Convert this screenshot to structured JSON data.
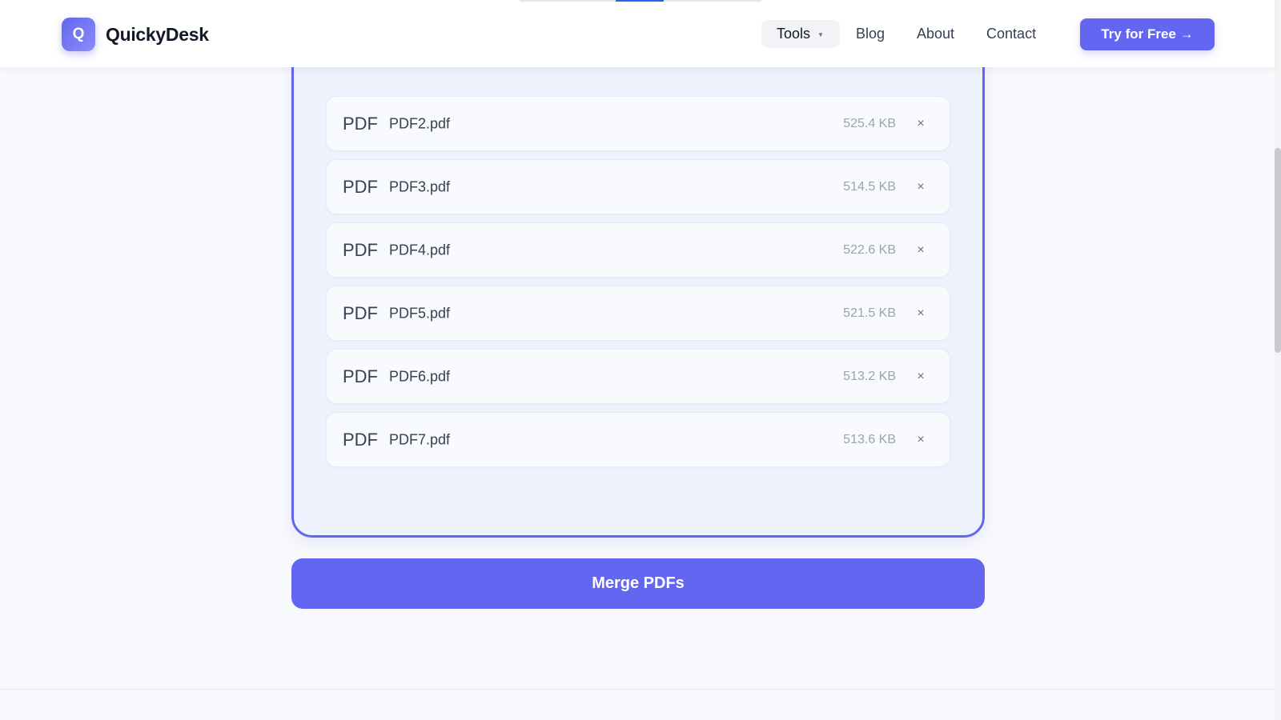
{
  "header": {
    "brand": {
      "logo_letter": "Q",
      "name": "QuickyDesk"
    },
    "nav": {
      "tools_label": "Tools",
      "blog_label": "Blog",
      "about_label": "About",
      "contact_label": "Contact"
    },
    "cta_label": "Try for Free →"
  },
  "files": [
    {
      "type": "PDF",
      "name": "PDF2.pdf",
      "size": "525.4 KB",
      "remove": "×"
    },
    {
      "type": "PDF",
      "name": "PDF3.pdf",
      "size": "514.5 KB",
      "remove": "×"
    },
    {
      "type": "PDF",
      "name": "PDF4.pdf",
      "size": "522.6 KB",
      "remove": "×"
    },
    {
      "type": "PDF",
      "name": "PDF5.pdf",
      "size": "521.5 KB",
      "remove": "×"
    },
    {
      "type": "PDF",
      "name": "PDF6.pdf",
      "size": "513.2 KB",
      "remove": "×"
    },
    {
      "type": "PDF",
      "name": "PDF7.pdf",
      "size": "513.6 KB",
      "remove": "×"
    }
  ],
  "merge_label": "Merge PDFs",
  "icons": {
    "logo": "q-logo-icon",
    "tools_dropdown": "chevron-down-icon",
    "remove": "close-icon"
  },
  "colors": {
    "accent": "#6366f1",
    "background": "#f8f9fc",
    "drop_zone_bg": "#eef2fc",
    "file_item_bg": "#f8fafd",
    "size_text": "#9ca3af"
  }
}
